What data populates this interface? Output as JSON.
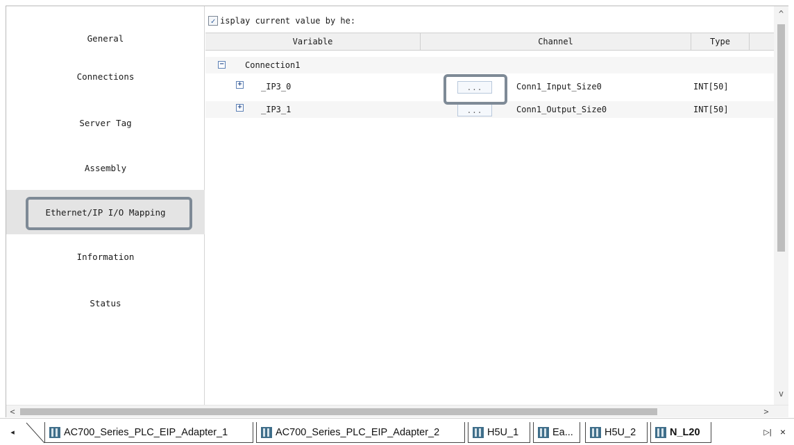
{
  "sidebar": {
    "items": [
      {
        "label": "General"
      },
      {
        "label": "Connections"
      },
      {
        "label": "Server Tag"
      },
      {
        "label": "Assembly"
      },
      {
        "label": "Ethernet/IP I/O Mapping"
      },
      {
        "label": "Information"
      },
      {
        "label": "Status"
      }
    ],
    "active_index": 4
  },
  "main": {
    "hex_checkbox_label": "isplay current value by he:",
    "hex_checkbox_checked": true,
    "columns": {
      "variable": "Variable",
      "channel": "Channel",
      "type": "Type"
    },
    "group": {
      "label": "Connection1",
      "expander": "−"
    },
    "rows": [
      {
        "variable": "_IP3_0",
        "button": "...",
        "channel": "Conn1_Input_Size0",
        "type": "INT[50]",
        "expander": "+"
      },
      {
        "variable": "_IP3_1",
        "button": "...",
        "channel": "Conn1_Output_Size0",
        "type": "INT[50]",
        "expander": "+"
      }
    ]
  },
  "scrollbars": {
    "up": "^",
    "down": "v",
    "left": "<",
    "right": ">"
  },
  "tabs": {
    "nav_left": "◂",
    "nav_right": "▷|",
    "close": "×",
    "items": [
      {
        "label": "AC700_Series_PLC_EIP_Adapter_1"
      },
      {
        "label": "AC700_Series_PLC_EIP_Adapter_2"
      },
      {
        "label": "H5U_1"
      },
      {
        "label": "Ea..."
      },
      {
        "label": "H5U_2"
      },
      {
        "label": "N_L20"
      }
    ],
    "active_index": 5
  },
  "colors": {
    "highlight_border": "#7e8a96",
    "active_sidebar_bg": "#e4e4e4",
    "header_bg": "#f0f0f0"
  }
}
